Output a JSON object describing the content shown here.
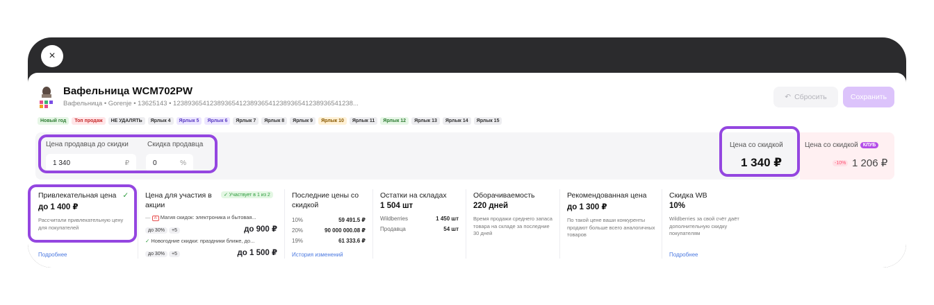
{
  "window": {
    "close_label": "×"
  },
  "product": {
    "title": "Вафельница WCM702PW",
    "subtitle": "Вафельница • Gorenje • 13625143 • 1238936541238936541238936541238936541238936541238..."
  },
  "actions": {
    "reset_label": "Сбросить",
    "save_label": "Сохранить"
  },
  "tags": [
    {
      "label": "Новый год",
      "bg": "#e6f6e6",
      "color": "#2e7d32"
    },
    {
      "label": "Топ продаж",
      "bg": "#ffe5e8",
      "color": "#c62828"
    },
    {
      "label": "НЕ УДАЛЯТЬ",
      "bg": "#ededf0",
      "color": "#333333"
    },
    {
      "label": "Ярлык 4",
      "bg": "#ededf0",
      "color": "#333333"
    },
    {
      "label": "Ярлык 5",
      "bg": "#ece6ff",
      "color": "#5b3dc4"
    },
    {
      "label": "Ярлык 6",
      "bg": "#ece6ff",
      "color": "#5b3dc4"
    },
    {
      "label": "Ярлык 7",
      "bg": "#ededf0",
      "color": "#333333"
    },
    {
      "label": "Ярлык 8",
      "bg": "#ededf0",
      "color": "#333333"
    },
    {
      "label": "Ярлык 9",
      "bg": "#ededf0",
      "color": "#333333"
    },
    {
      "label": "Ярлык 10",
      "bg": "#fff1d6",
      "color": "#8a5a00"
    },
    {
      "label": "Ярлык 11",
      "bg": "#ededf0",
      "color": "#333333"
    },
    {
      "label": "Ярлык 12",
      "bg": "#e6f6e6",
      "color": "#2e7d32"
    },
    {
      "label": "Ярлык 13",
      "bg": "#ededf0",
      "color": "#333333"
    },
    {
      "label": "Ярлык 14",
      "bg": "#ededf0",
      "color": "#333333"
    },
    {
      "label": "Ярлык 15",
      "bg": "#ededf0",
      "color": "#333333"
    }
  ],
  "pricing": {
    "seller_price_label": "Цена продавца до скидки",
    "seller_price_value": "1 340",
    "currency": "₽",
    "seller_discount_label": "Скидка продавца",
    "seller_discount_value": "0",
    "percent": "%",
    "discounted_label": "Цена со скидкой",
    "discounted_value": "1 340 ₽",
    "club_label": "Цена со скидкой",
    "club_badge": "КЛУБ",
    "club_percent": "-10%",
    "club_value": "1 206 ₽"
  },
  "cards": {
    "attractive": {
      "title": "Привлекательная цена",
      "value": "до 1 400 ₽",
      "desc": "Рассчитали привлекательную цену для покупателей",
      "link": "Подробнее"
    },
    "promo": {
      "title": "Цена для участия в акции",
      "badge": "✓ Участвует в 1 из 2",
      "items": [
        {
          "name": "Магия скидок: электроника и бытовая...",
          "chip1": "до 30%",
          "chip2": "+5",
          "price": "до 900 ₽"
        },
        {
          "name": "Новогодние скидки: праздники ближе, до...",
          "chip1": "до 30%",
          "chip2": "+5",
          "price": "до 1 500 ₽"
        }
      ]
    },
    "last_prices": {
      "title": "Последние цены со скидкой",
      "rows": [
        {
          "k": "10%",
          "v": "59 491.5 ₽"
        },
        {
          "k": "20%",
          "v": "90 000 000.08 ₽"
        },
        {
          "k": "19%",
          "v": "61 333.6 ₽"
        }
      ],
      "link": "История изменений"
    },
    "stock": {
      "title": "Остатки на складах",
      "value": "1 504 шт",
      "rows": [
        {
          "k": "Wildberries",
          "v": "1 450 шт"
        },
        {
          "k": "Продавца",
          "v": "54 шт"
        }
      ]
    },
    "turnover": {
      "title": "Оборачиваемость",
      "value": "220 дней",
      "desc": "Время продажи среднего запаса товара на складе за последние 30 дней"
    },
    "recommended": {
      "title": "Рекомендованная цена",
      "value": "до 1 300 ₽",
      "desc": "По такой цене ваши конкуренты продают больше всего аналогичных товаров"
    },
    "wb_discount": {
      "title": "Скидка WB",
      "value": "10%",
      "desc": "Wildberries за свой счёт даёт дополнительную скидку покупателям",
      "link": "Подробнее"
    }
  },
  "colors": {
    "highlight": "#9446e0",
    "accent_link": "#4a78e0",
    "save_disabled": "#dcc3fb"
  }
}
